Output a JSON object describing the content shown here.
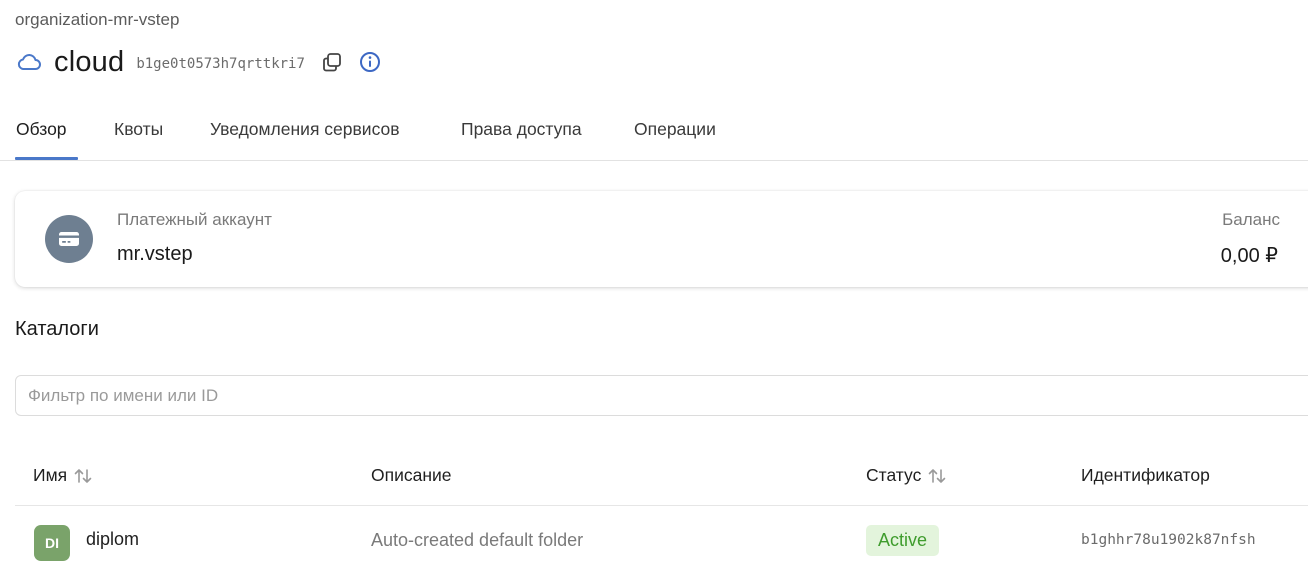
{
  "organization": "organization-mr-vstep",
  "cloud": {
    "title": "cloud",
    "id": "b1ge0t0573h7qrttkri7",
    "icon": "cloud-icon",
    "actions": [
      {
        "icon": "copy-icon"
      },
      {
        "icon": "info-icon"
      }
    ]
  },
  "tabs": [
    {
      "label": "Обзор",
      "active": true
    },
    {
      "label": "Квоты"
    },
    {
      "label": "Уведомления сервисов"
    },
    {
      "label": "Права доступа"
    },
    {
      "label": "Операции"
    }
  ],
  "billing": {
    "label": "Платежный аккаунт",
    "name": "mr.vstep",
    "balance_label": "Баланс",
    "balance_value": "0,00 ₽",
    "icon": "credit-card-icon"
  },
  "catalogs": {
    "title": "Каталоги",
    "filter_placeholder": "Фильтр по имени или ID",
    "filter_value": "",
    "columns": [
      {
        "label": "Имя",
        "sortable": true
      },
      {
        "label": "Описание",
        "sortable": false
      },
      {
        "label": "Статус",
        "sortable": true
      },
      {
        "label": "Идентификатор",
        "sortable": false
      }
    ],
    "rows": [
      {
        "avatar": "DI",
        "name": "diplom",
        "description": "Auto-created default folder",
        "status": "Active",
        "id": "b1ghhr78u1902k87nfsh"
      }
    ]
  },
  "colors": {
    "accent": "#4a78c9",
    "avatar_bg": "#7aa36a",
    "status_bg": "#e3f4dc",
    "status_text": "#3f9c2d",
    "billing_icon_bg": "#6e7f91"
  }
}
